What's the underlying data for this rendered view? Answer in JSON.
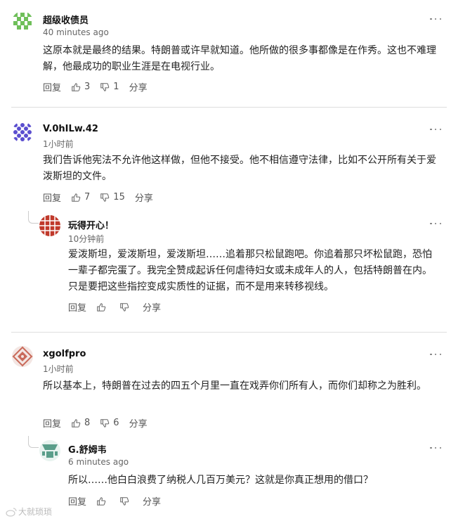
{
  "comments": [
    {
      "username": "超级收债员",
      "time": "40 minutes ago",
      "text": "这原本就是最终的结果。特朗普或许早就知道。他所做的很多事都像是在作秀。这也不难理解，他最成功的职业生涯是在电视行业。",
      "reply": "回复",
      "likes": "3",
      "dislikes": "1",
      "share": "分享"
    },
    {
      "username": "V.0hILw.42",
      "time": "1小时前",
      "text": "我们告诉他宪法不允许他这样做，但他不接受。他不相信遵守法律，比如不公开所有关于爱泼斯坦的文件。",
      "reply": "回复",
      "likes": "7",
      "dislikes": "15",
      "share": "分享"
    },
    {
      "username": "玩得开心！",
      "time": "10分钟前",
      "text": "爱泼斯坦，爱泼斯坦，爱泼斯坦……追着那只松鼠跑吧。你追着那只坏松鼠跑，恐怕一辈子都完蛋了。我完全赞成起诉任何虐待妇女或未成年人的人，包括特朗普在内。只是要把这些指控变成实质性的证据，而不是用来转移视线。",
      "reply": "回复",
      "likes": "",
      "dislikes": "",
      "share": "分享"
    },
    {
      "username": "xgolfpro",
      "time": "1小时前",
      "text": "所以基本上，特朗普在过去的四五个月里一直在戏弄你们所有人，而你们却称之为胜利。",
      "reply": "回复",
      "likes": "8",
      "dislikes": "6",
      "share": "分享"
    },
    {
      "username": "G.舒姆韦",
      "time": "6 minutes ago",
      "text": "所以……他白白浪费了纳税人几百万美元？这就是你真正想用的借口？",
      "reply": "回复",
      "likes": "",
      "dislikes": "",
      "share": "分享"
    }
  ],
  "watermark": "大就琐琐",
  "colors": {
    "avatar1": "#6fbf5a",
    "avatar2": "#5b4fcf",
    "avatar3": "#c0392b",
    "avatar4": "#c96a5a",
    "avatar5": "#5a9e8a"
  }
}
